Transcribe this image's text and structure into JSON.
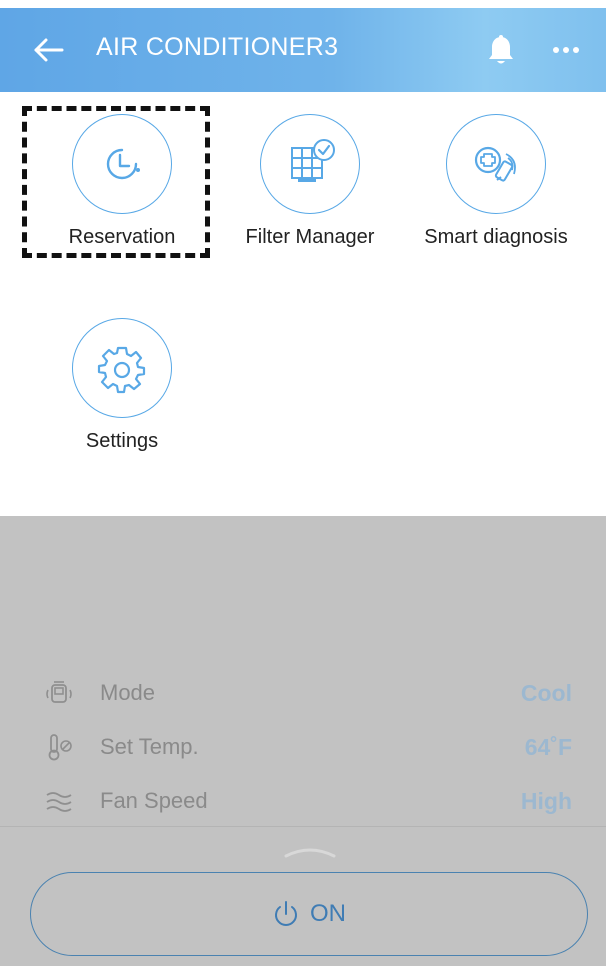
{
  "header": {
    "title": "AIR CONDITIONER3"
  },
  "functions": [
    {
      "label": "Reservation",
      "icon": "clock-icon"
    },
    {
      "label": "Filter Manager",
      "icon": "filter-icon"
    },
    {
      "label": "Smart diagnosis",
      "icon": "diagnosis-icon"
    },
    {
      "label": "Settings",
      "icon": "gear-icon"
    }
  ],
  "status": {
    "mode": {
      "label": "Mode",
      "value": "Cool"
    },
    "temp": {
      "label": "Set Temp.",
      "value": "64˚F"
    },
    "fan": {
      "label": "Fan Speed",
      "value": "High"
    }
  },
  "power": {
    "label": "ON"
  },
  "colors": {
    "header_start": "#5fa6e6",
    "header_end": "#8ecbf2",
    "accent": "#58a8e6",
    "panel_bg": "#c2c2c2",
    "value_text": "#9cb8d0",
    "power_text": "#3f7cb4"
  }
}
